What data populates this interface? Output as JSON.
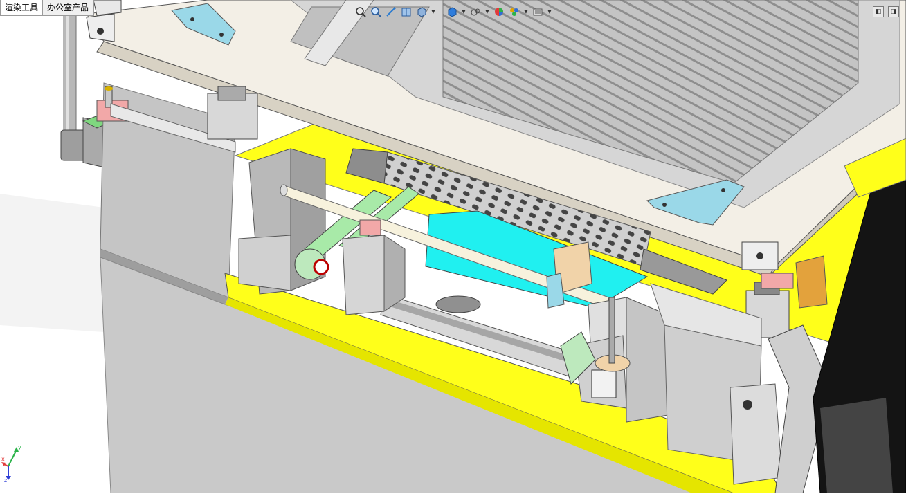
{
  "app": {
    "tabs": [
      {
        "label": "渲染工具"
      },
      {
        "label": "办公室产品"
      }
    ]
  },
  "heads_up_toolbar": {
    "buttons": [
      {
        "icon": "zoom-to-fit-icon",
        "caret": false
      },
      {
        "icon": "zoom-to-area-icon",
        "caret": false
      },
      {
        "icon": "previous-view-icon",
        "caret": false
      },
      {
        "icon": "section-view-icon",
        "caret": false
      },
      {
        "icon": "view-orientation-icon",
        "caret": true
      },
      {
        "icon": "display-style-icon",
        "caret": true
      },
      {
        "icon": "hide-show-items-icon",
        "caret": true
      },
      {
        "icon": "edit-appearance-icon",
        "caret": false
      },
      {
        "icon": "apply-scene-icon",
        "caret": true
      },
      {
        "icon": "view-settings-icon",
        "caret": true
      }
    ]
  },
  "triad": {
    "x_label": "x",
    "y_label": "y",
    "z_label": "z"
  },
  "colors": {
    "frame_plate": "#f3efe6",
    "base_plate_yellow": "#ffff1a",
    "cyan_block": "#20f0f0",
    "side_panel_gray": "#bdbdbd",
    "belt_green": "#a8eaa8",
    "bracket_blue": "#9ad8e8"
  }
}
